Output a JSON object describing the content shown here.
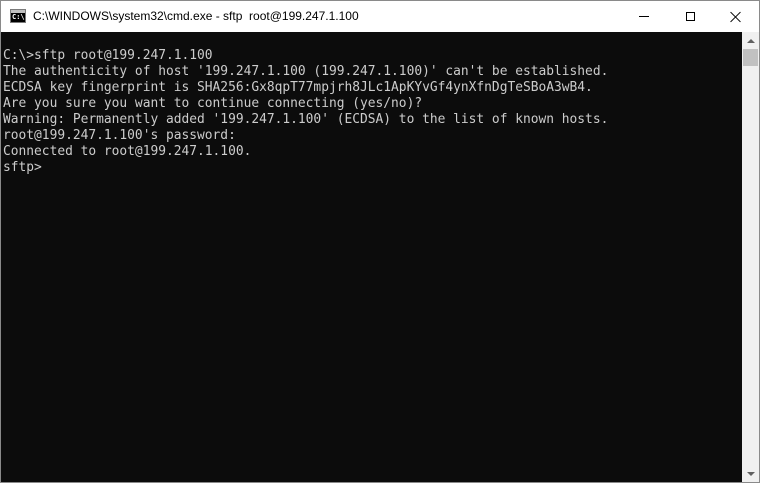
{
  "window": {
    "title": "C:\\WINDOWS\\system32\\cmd.exe - sftp  root@199.247.1.100",
    "icon": "cmd-icon",
    "icon_glyph": "C:\\."
  },
  "controls": {
    "minimize_icon": "minimize-icon",
    "maximize_icon": "maximize-icon",
    "close_icon": "close-icon"
  },
  "console": {
    "background": "#0c0c0c",
    "foreground": "#cccccc",
    "lines": [
      "C:\\>sftp root@199.247.1.100",
      "The authenticity of host '199.247.1.100 (199.247.1.100)' can't be established.",
      "ECDSA key fingerprint is SHA256:Gx8qpT77mpjrh8JLc1ApKYvGf4ynXfnDgTeSBoA3wB4.",
      "Are you sure you want to continue connecting (yes/no)?",
      "Warning: Permanently added '199.247.1.100' (ECDSA) to the list of known hosts.",
      "root@199.247.1.100's password:",
      "Connected to root@199.247.1.100.",
      "sftp>"
    ]
  },
  "scrollbar": {
    "up_icon": "scroll-up-arrow-icon",
    "down_icon": "scroll-down-arrow-icon"
  }
}
